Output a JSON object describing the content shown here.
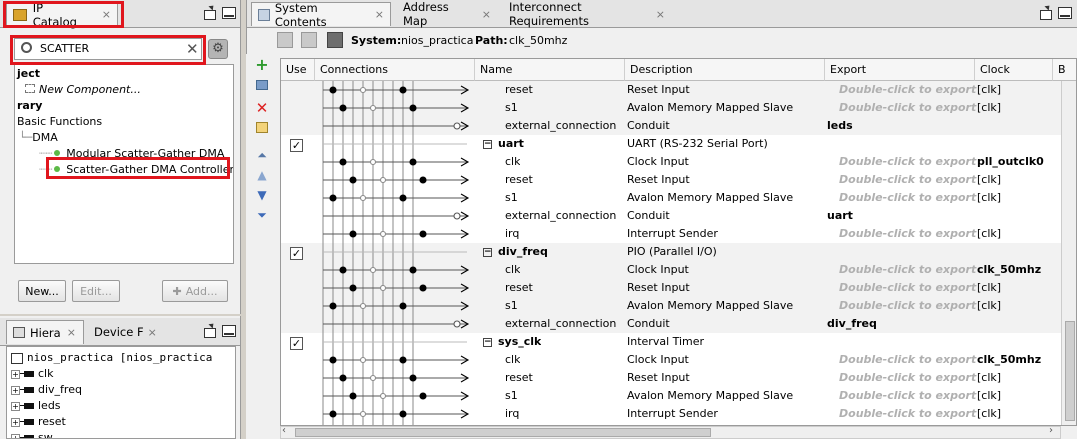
{
  "ip_catalog": {
    "tab_label": "IP Catalog",
    "search_value": "SCATTER",
    "tree": [
      {
        "label": "ject",
        "bold": true,
        "indent": 0
      },
      {
        "label": "New Component...",
        "italic": true,
        "indent": 1
      },
      {
        "label": "rary",
        "bold": true,
        "indent": 0
      },
      {
        "label": "Basic Functions",
        "indent": 0
      },
      {
        "label": "DMA",
        "indent": 1
      },
      {
        "label": "Modular Scatter-Gather DMA",
        "indent": 3
      },
      {
        "label": "Scatter-Gather DMA Controller",
        "indent": 3
      }
    ],
    "buttons": {
      "new": "New...",
      "edit": "Edit...",
      "add": "Add..."
    }
  },
  "hierarchy": {
    "tab_label": "Hiera",
    "tab2_label": "Device F",
    "root": "nios_practica [nios_practica",
    "items": [
      "clk",
      "div_freq",
      "leds",
      "reset",
      "sw"
    ]
  },
  "system": {
    "tabs": [
      "System Contents",
      "Address Map",
      "Interconnect Requirements"
    ],
    "system_label": "System:",
    "system_name": "nios_practica",
    "path_label": "Path:",
    "path_value": "clk_50mhz",
    "columns": [
      "Use",
      "Connections",
      "Name",
      "Description",
      "Export",
      "Clock",
      "B"
    ],
    "rows": [
      {
        "name": "reset",
        "desc": "Reset Input",
        "export": "Double-click to export",
        "clock": "[clk]"
      },
      {
        "name": "s1",
        "desc": "Avalon Memory Mapped Slave",
        "export": "Double-click to export",
        "clock": "[clk]"
      },
      {
        "name": "external_connection",
        "desc": "Conduit",
        "export": "leds",
        "clock": ""
      },
      {
        "name": "uart",
        "desc": "UART (RS-232 Serial Port)",
        "export": "",
        "clock": "",
        "component": true
      },
      {
        "name": "clk",
        "desc": "Clock Input",
        "export": "Double-click to export",
        "clock": "pll_outclk0"
      },
      {
        "name": "reset",
        "desc": "Reset Input",
        "export": "Double-click to export",
        "clock": "[clk]"
      },
      {
        "name": "s1",
        "desc": "Avalon Memory Mapped Slave",
        "export": "Double-click to export",
        "clock": "[clk]"
      },
      {
        "name": "external_connection",
        "desc": "Conduit",
        "export": "uart",
        "clock": ""
      },
      {
        "name": "irq",
        "desc": "Interrupt Sender",
        "export": "Double-click to export",
        "clock": "[clk]"
      },
      {
        "name": "div_freq",
        "desc": "PIO (Parallel I/O)",
        "export": "",
        "clock": "",
        "component": true
      },
      {
        "name": "clk",
        "desc": "Clock Input",
        "export": "Double-click to export",
        "clock": "clk_50mhz"
      },
      {
        "name": "reset",
        "desc": "Reset Input",
        "export": "Double-click to export",
        "clock": "[clk]"
      },
      {
        "name": "s1",
        "desc": "Avalon Memory Mapped Slave",
        "export": "Double-click to export",
        "clock": "[clk]"
      },
      {
        "name": "external_connection",
        "desc": "Conduit",
        "export": "div_freq",
        "clock": ""
      },
      {
        "name": "sys_clk",
        "desc": "Interval Timer",
        "export": "",
        "clock": "",
        "component": true
      },
      {
        "name": "clk",
        "desc": "Clock Input",
        "export": "Double-click to export",
        "clock": "clk_50mhz"
      },
      {
        "name": "reset",
        "desc": "Reset Input",
        "export": "Double-click to export",
        "clock": "[clk]"
      },
      {
        "name": "s1",
        "desc": "Avalon Memory Mapped Slave",
        "export": "Double-click to export",
        "clock": "[clk]"
      },
      {
        "name": "irq",
        "desc": "Interrupt Sender",
        "export": "Double-click to export",
        "clock": "[clk]"
      }
    ]
  },
  "colors": {
    "highlight_box": "#e0161d",
    "export_hint": "#b0b0b0"
  }
}
